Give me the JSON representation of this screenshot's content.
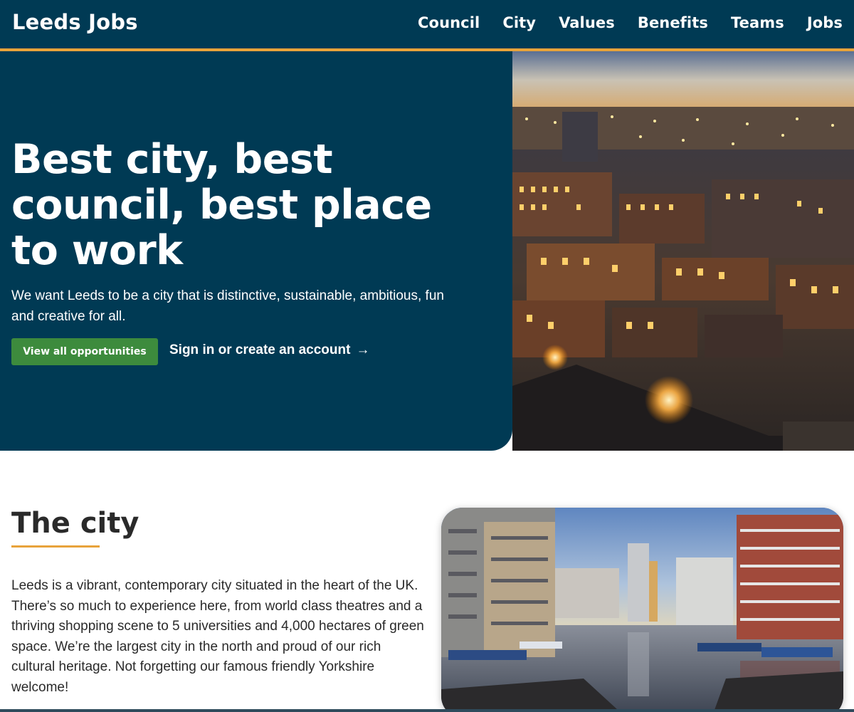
{
  "header": {
    "brand": "Leeds Jobs",
    "nav": [
      "Council",
      "City",
      "Values",
      "Benefits",
      "Teams",
      "Jobs"
    ]
  },
  "hero": {
    "title": "Best city, best council, best place to work",
    "description": "We want Leeds to be a city that is distinctive, sustainable, ambitious, fun and creative for all.",
    "primary_button": "View all opportunities",
    "signin_link": "Sign in or create an account",
    "signin_arrow": "→"
  },
  "city_section": {
    "title": "The city",
    "body": "Leeds is a vibrant, contemporary city situated in the heart of the UK. There’s so much to experience here, from world class theatres and a thriving shopping scene to 5 universities and 4,000 hectares of green space. We’re the largest city in the north and proud of our rich cultural heritage. Not forgetting our famous friendly Yorkshire welcome!"
  },
  "colors": {
    "navy": "#003a54",
    "accent": "#e8a33b",
    "button_green": "#3d8b3d"
  }
}
